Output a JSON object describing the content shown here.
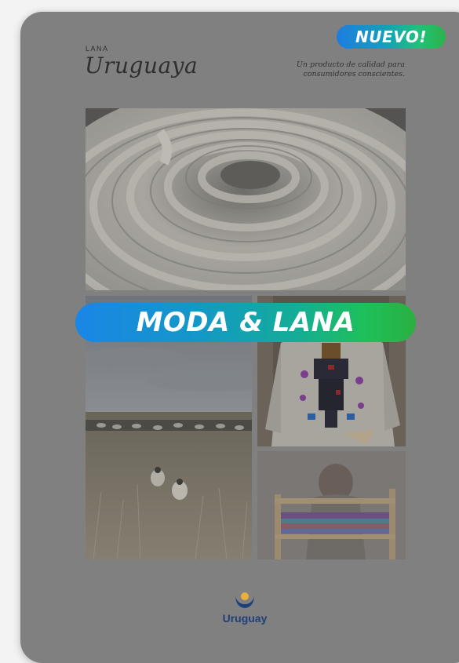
{
  "header": {
    "brand_small": "LANA",
    "brand": "Uruguaya",
    "badge": "NUEVO!",
    "tagline_line1": "Un producto de calidad para",
    "tagline_line2": "consumidores conscientes."
  },
  "banner": {
    "title": "MODA & LANA"
  },
  "footer": {
    "country": "Uruguay"
  },
  "colors": {
    "card": "#808080",
    "gradient_start": "#1a86e6",
    "gradient_end": "#2ab040",
    "logo_blue": "#1f3f7a",
    "logo_gold": "#e8b23a"
  }
}
